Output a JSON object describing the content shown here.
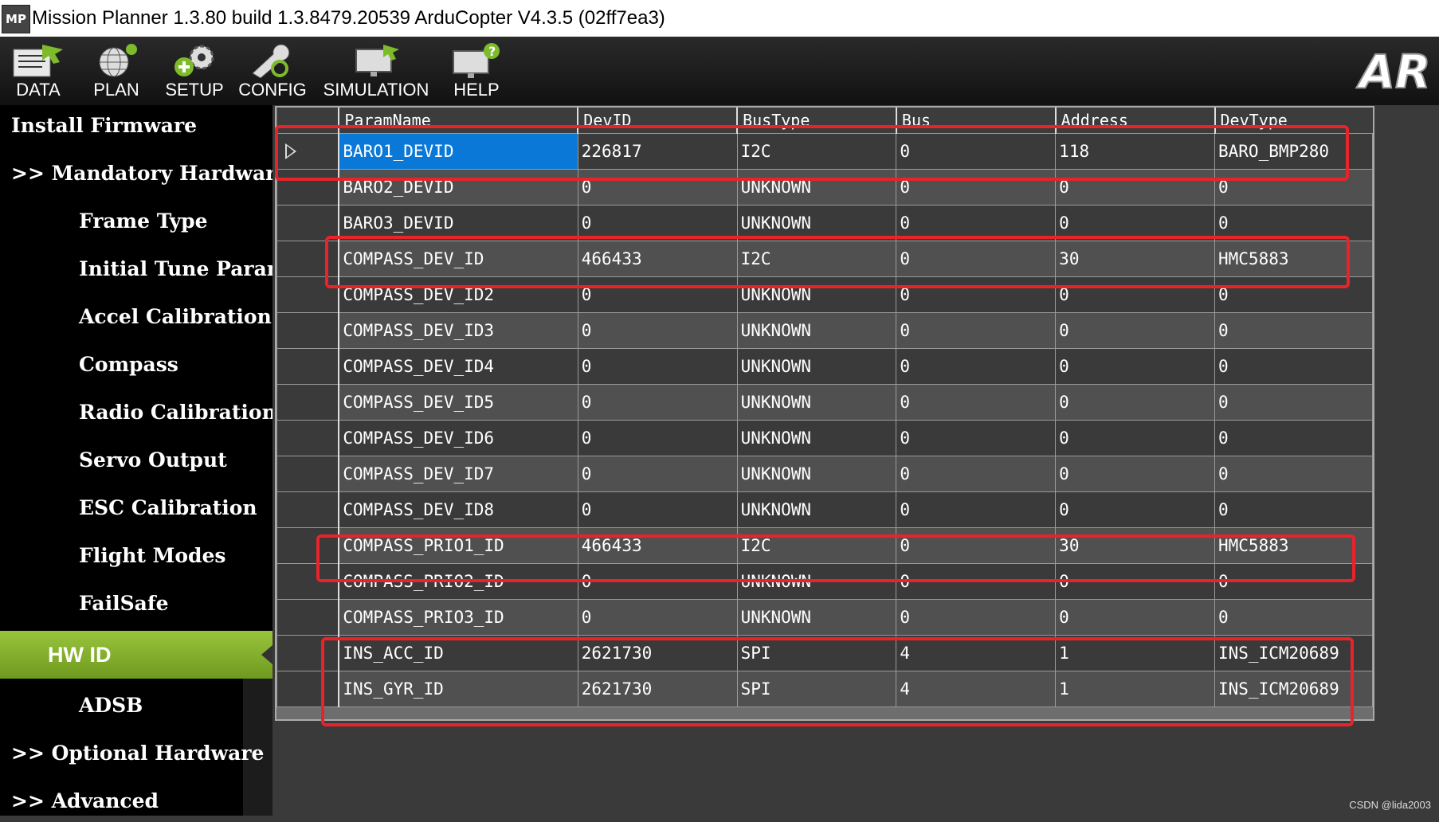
{
  "window": {
    "icon_text": "MP",
    "title": "Mission Planner 1.3.80 build 1.3.8479.20539 ArduCopter V4.3.5 (02ff7ea3)"
  },
  "toolbar": {
    "buttons": [
      {
        "label": "DATA",
        "icon": "data-icon"
      },
      {
        "label": "PLAN",
        "icon": "plan-globe-icon"
      },
      {
        "label": "SETUP",
        "icon": "setup-gears-icon"
      },
      {
        "label": "CONFIG",
        "icon": "config-wrench-icon"
      },
      {
        "label": "SIMULATION",
        "icon": "simulation-monitor-icon"
      },
      {
        "label": "HELP",
        "icon": "help-monitor-icon"
      }
    ],
    "logo_text": "AR"
  },
  "sidebar": {
    "items": [
      {
        "label": "Install Firmware"
      },
      {
        "label": ">> Mandatory Hardware"
      },
      {
        "label": "Frame Type"
      },
      {
        "label": "Initial Tune Parameters"
      },
      {
        "label": "Accel Calibration"
      },
      {
        "label": "Compass"
      },
      {
        "label": "Radio Calibration"
      },
      {
        "label": "Servo Output"
      },
      {
        "label": "ESC Calibration"
      },
      {
        "label": "Flight Modes"
      },
      {
        "label": "FailSafe"
      },
      {
        "label": "HW ID"
      },
      {
        "label": "ADSB"
      },
      {
        "label": ">> Optional Hardware"
      },
      {
        "label": ">> Advanced"
      }
    ],
    "active": "HW ID"
  },
  "grid": {
    "columns": [
      "ParamName",
      "DevID",
      "BusType",
      "Bus",
      "Address",
      "DevType"
    ],
    "rows": [
      [
        "BARO1_DEVID",
        "226817",
        "I2C",
        "0",
        "118",
        "BARO_BMP280"
      ],
      [
        "BARO2_DEVID",
        "0",
        "UNKNOWN",
        "0",
        "0",
        "0"
      ],
      [
        "BARO3_DEVID",
        "0",
        "UNKNOWN",
        "0",
        "0",
        "0"
      ],
      [
        "COMPASS_DEV_ID",
        "466433",
        "I2C",
        "0",
        "30",
        "HMC5883"
      ],
      [
        "COMPASS_DEV_ID2",
        "0",
        "UNKNOWN",
        "0",
        "0",
        "0"
      ],
      [
        "COMPASS_DEV_ID3",
        "0",
        "UNKNOWN",
        "0",
        "0",
        "0"
      ],
      [
        "COMPASS_DEV_ID4",
        "0",
        "UNKNOWN",
        "0",
        "0",
        "0"
      ],
      [
        "COMPASS_DEV_ID5",
        "0",
        "UNKNOWN",
        "0",
        "0",
        "0"
      ],
      [
        "COMPASS_DEV_ID6",
        "0",
        "UNKNOWN",
        "0",
        "0",
        "0"
      ],
      [
        "COMPASS_DEV_ID7",
        "0",
        "UNKNOWN",
        "0",
        "0",
        "0"
      ],
      [
        "COMPASS_DEV_ID8",
        "0",
        "UNKNOWN",
        "0",
        "0",
        "0"
      ],
      [
        "COMPASS_PRIO1_ID",
        "466433",
        "I2C",
        "0",
        "30",
        "HMC5883"
      ],
      [
        "COMPASS_PRIO2_ID",
        "0",
        "UNKNOWN",
        "0",
        "0",
        "0"
      ],
      [
        "COMPASS_PRIO3_ID",
        "0",
        "UNKNOWN",
        "0",
        "0",
        "0"
      ],
      [
        "INS_ACC_ID",
        "2621730",
        "SPI",
        "4",
        "1",
        "INS_ICM20689"
      ],
      [
        "INS_GYR_ID",
        "2621730",
        "SPI",
        "4",
        "1",
        "INS_ICM20689"
      ]
    ],
    "selected_row": 0
  },
  "colors": {
    "highlight": "#e8232a",
    "selection": "#0a78d7",
    "active_tab": "#8bb833"
  },
  "watermark": "CSDN @lida2003"
}
